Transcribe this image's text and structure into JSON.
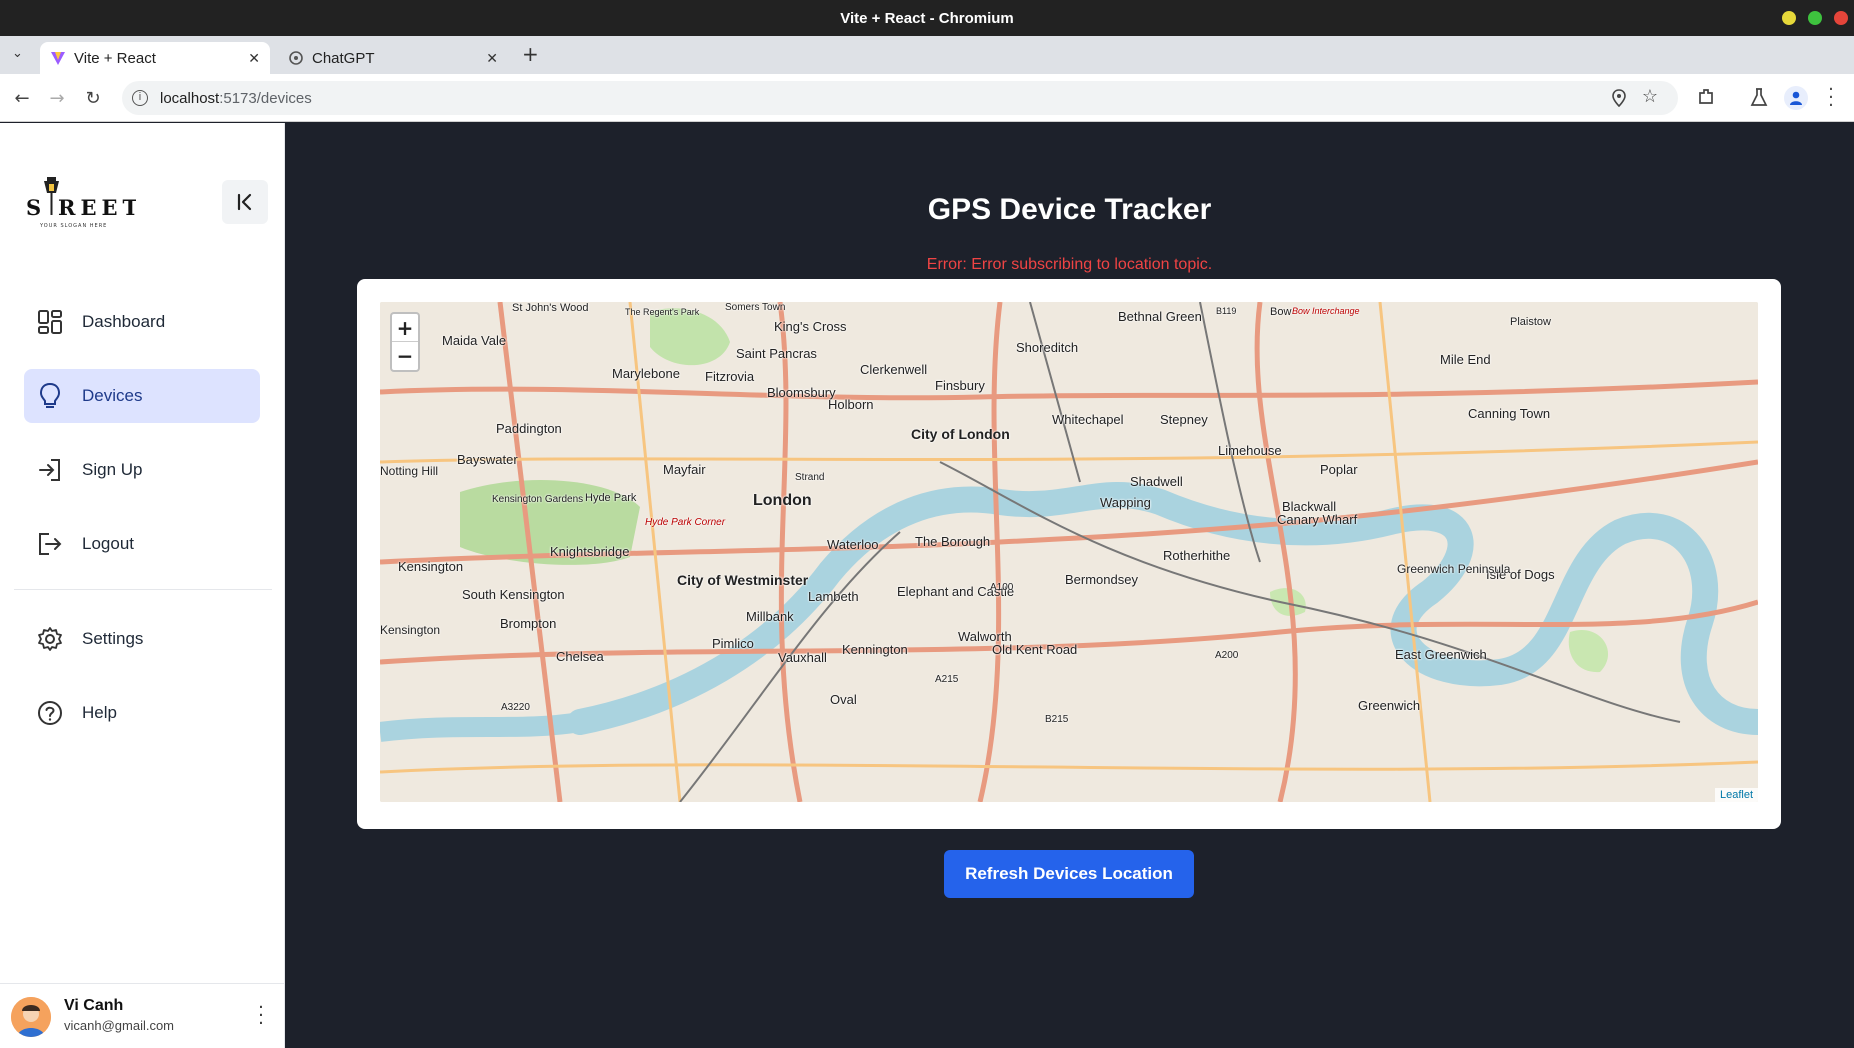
{
  "window": {
    "title": "Vite + React - Chromium"
  },
  "tabs": [
    {
      "label": "Vite + React",
      "active": true
    },
    {
      "label": "ChatGPT",
      "active": false
    }
  ],
  "toolbar": {
    "url_host": "localhost",
    "url_path": ":5173/devices"
  },
  "sidebar": {
    "logo_text": "STREET",
    "logo_tagline": "YOUR SLOGAN HERE",
    "nav": [
      {
        "label": "Dashboard",
        "icon": "dashboard-icon"
      },
      {
        "label": "Devices",
        "icon": "lightbulb-icon",
        "active": true
      },
      {
        "label": "Sign Up",
        "icon": "sign-in-icon"
      },
      {
        "label": "Logout",
        "icon": "logout-icon"
      }
    ],
    "secondary": [
      {
        "label": "Settings",
        "icon": "gear-icon"
      },
      {
        "label": "Help",
        "icon": "help-icon"
      }
    ],
    "user": {
      "name": "Vi Canh",
      "email": "vicanh@gmail.com"
    }
  },
  "main": {
    "title": "GPS Device Tracker",
    "error": "Error: Error subscribing to location topic.",
    "refresh_label": "Refresh Devices Location"
  },
  "map": {
    "zoom_in": "+",
    "zoom_out": "−",
    "attribution": "Leaflet",
    "labels": [
      "St John's Wood",
      "The Regent's Park",
      "Somers Town",
      "King's Cross",
      "Bethnal Green",
      "B119",
      "Bow",
      "Bow Interchange",
      "Plaistow",
      "Maida Vale",
      "Saint Pancras",
      "Shoreditch",
      "Mile End",
      "Marylebone",
      "Fitzrovia",
      "Clerkenwell",
      "Finsbury",
      "Bloomsbury",
      "Holborn",
      "Paddington",
      "City of London",
      "Whitechapel",
      "Stepney",
      "Canning Town",
      "Limehouse",
      "Bayswater",
      "Mayfair",
      "Poplar",
      "Notting Hill",
      "Shadwell",
      "Hyde Park",
      "Kensington Gardens",
      "London",
      "Strand",
      "Wapping",
      "Blackwall",
      "Hyde Park Corner",
      "Canary Wharf",
      "Waterloo",
      "The Borough",
      "Knightsbridge",
      "Rotherhithe",
      "Kensington",
      "City of Westminster",
      "Isle of Dogs",
      "Greenwich Peninsula",
      "South Kensington",
      "Lambeth",
      "Elephant and Castle",
      "A100",
      "Bermondsey",
      "Kensington",
      "Brompton",
      "Millbank",
      "Walworth",
      "Pimlico",
      "Chelsea",
      "Vauxhall",
      "Kennington",
      "Old Kent Road",
      "East Greenwich",
      "A200",
      "A215",
      "Oval",
      "Greenwich",
      "A3220",
      "B215"
    ]
  },
  "colors": {
    "accent": "#2563eb",
    "error": "#ef4444",
    "main_bg": "#1d212b",
    "active_nav": "#dde3ff"
  }
}
